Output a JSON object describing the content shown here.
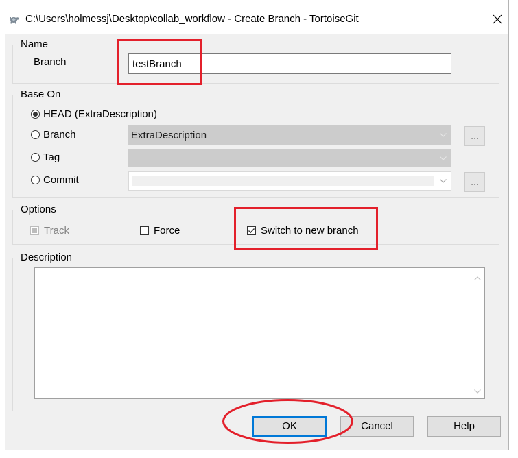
{
  "window": {
    "title": "C:\\Users\\holmessj\\Desktop\\collab_workflow - Create Branch - TortoiseGit",
    "app_icon": "tortoisegit-icon",
    "close_icon": "close-icon"
  },
  "name_group": {
    "label": "Name",
    "branch_label": "Branch",
    "branch_value": "testBranch"
  },
  "base_on_group": {
    "label": "Base On",
    "head": {
      "label": "HEAD (ExtraDescription)",
      "selected": true
    },
    "branch": {
      "label": "Branch",
      "selected": false,
      "value": "ExtraDescription",
      "enabled": false
    },
    "tag": {
      "label": "Tag",
      "selected": false,
      "value": "",
      "enabled": false
    },
    "commit": {
      "label": "Commit",
      "selected": false,
      "value": "",
      "enabled": false
    },
    "browse_label": "..."
  },
  "options_group": {
    "label": "Options",
    "track": {
      "label": "Track",
      "indeterminate": true,
      "enabled": false
    },
    "force": {
      "label": "Force",
      "checked": false
    },
    "switch_to_new_branch": {
      "label": "Switch to new branch",
      "checked": true
    }
  },
  "description_group": {
    "label": "Description",
    "value": ""
  },
  "buttons": {
    "ok": "OK",
    "cancel": "Cancel",
    "help": "Help"
  },
  "colors": {
    "annotation_red": "#e3202b",
    "focus_blue": "#0078d7",
    "dialog_bg": "#f0f0f0"
  }
}
